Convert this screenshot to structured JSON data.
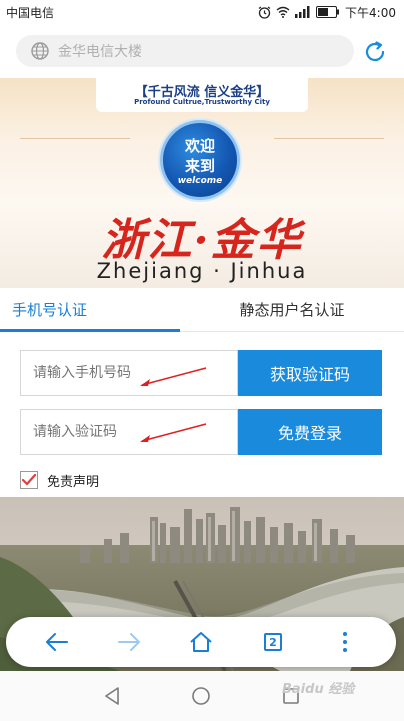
{
  "status_bar": {
    "carrier": "中国电信",
    "time": "下午4:00"
  },
  "address_bar": {
    "url_text": "金华电信大楼"
  },
  "banner": {
    "slogan": "【千古风流 信义金华】",
    "slogan_en": "Profound Cultrue,Trustworthy City",
    "badge_line1": "欢迎",
    "badge_line2": "来到",
    "badge_en": "welcome",
    "title": "浙江·金华",
    "subtitle": "Zhejiang · Jinhua"
  },
  "tabs": [
    {
      "label": "手机号认证",
      "active": true
    },
    {
      "label": "静态用户名认证",
      "active": false
    }
  ],
  "form": {
    "phone_placeholder": "请输入手机号码",
    "get_code_label": "获取验证码",
    "code_placeholder": "请输入验证码",
    "login_label": "免费登录",
    "disclaimer_label": "免责声明",
    "disclaimer_checked": true
  },
  "browser_toolbar": {
    "tab_count": "2"
  },
  "watermark": "Baidu 经验",
  "colors": {
    "accent": "#1a8bdc",
    "tab_active": "#1a7fd4",
    "arrow_red": "#e02020",
    "check_red": "#e63b3b"
  }
}
